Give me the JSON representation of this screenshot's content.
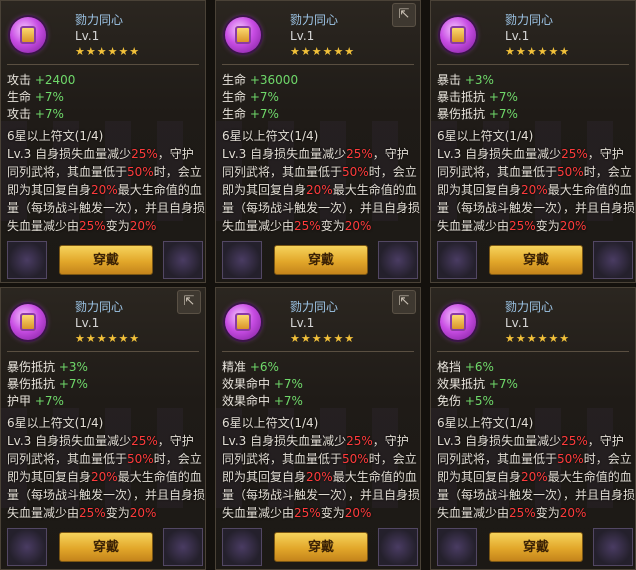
{
  "cards": [
    {
      "title": "勠力同心",
      "level": "Lv.1",
      "stars": "★★★★★★",
      "stats": [
        {
          "label": "攻击",
          "value": "+2400"
        },
        {
          "label": "生命",
          "value": "+7%"
        },
        {
          "label": "攻击",
          "value": "+7%"
        }
      ],
      "desc": {
        "line1": "6星以上符文(1/4)",
        "p1": "Lv.3  自身损失血量减少",
        "r1": "25%",
        "p2": "，守护同列武将，其血量低于",
        "r2": "50%",
        "p3": "时，会立即为其回复自身",
        "r3": "20%",
        "p4": "最大生命值的血量（每场战斗触发一次），并且自身损失血量减少由",
        "r4": "25%",
        "p5": "变为",
        "r5": "20%"
      },
      "button": "穿戴"
    },
    {
      "title": "勠力同心",
      "level": "Lv.1",
      "stars": "★★★★★★",
      "stats": [
        {
          "label": "生命",
          "value": "+36000"
        },
        {
          "label": "生命",
          "value": "+7%"
        },
        {
          "label": "生命",
          "value": "+7%"
        }
      ],
      "desc": {
        "line1": "6星以上符文(1/4)",
        "p1": "Lv.3  自身损失血量减少",
        "r1": "25%",
        "p2": "，守护同列武将，其血量低于",
        "r2": "50%",
        "p3": "时，会立即为其回复自身",
        "r3": "20%",
        "p4": "最大生命值的血量（每场战斗触发一次），并且自身损失血量减少由",
        "r4": "25%",
        "p5": "变为",
        "r5": "20%"
      },
      "button": "穿戴"
    },
    {
      "title": "勠力同心",
      "level": "Lv.1",
      "stars": "★★★★★★",
      "stats": [
        {
          "label": "暴击",
          "value": "+3%"
        },
        {
          "label": "暴击抵抗",
          "value": "+7%"
        },
        {
          "label": "暴伤抵抗",
          "value": "+7%"
        }
      ],
      "desc": {
        "line1": "6星以上符文(1/4)",
        "p1": "Lv.3  自身损失血量减少",
        "r1": "25%",
        "p2": "，守护同列武将，其血量低于",
        "r2": "50%",
        "p3": "时，会立即为其回复自身",
        "r3": "20%",
        "p4": "最大生命值的血量（每场战斗触发一次），并且自身损失血量减少由",
        "r4": "25%",
        "p5": "变为",
        "r5": "20%"
      },
      "button": "穿戴"
    },
    {
      "title": "勠力同心",
      "level": "Lv.1",
      "stars": "★★★★★★",
      "stats": [
        {
          "label": "暴伤抵抗",
          "value": "+3%"
        },
        {
          "label": "暴伤抵抗",
          "value": "+7%"
        },
        {
          "label": "护甲",
          "value": "+7%"
        }
      ],
      "desc": {
        "line1": "6星以上符文(1/4)",
        "p1": "Lv.3  自身损失血量减少",
        "r1": "25%",
        "p2": "，守护同列武将，其血量低于",
        "r2": "50%",
        "p3": "时，会立即为其回复自身",
        "r3": "20%",
        "p4": "最大生命值的血量（每场战斗触发一次），并且自身损失血量减少由",
        "r4": "25%",
        "p5": "变为",
        "r5": "20%"
      },
      "button": "穿戴"
    },
    {
      "title": "勠力同心",
      "level": "Lv.1",
      "stars": "★★★★★★",
      "stats": [
        {
          "label": "精准",
          "value": "+6%"
        },
        {
          "label": "效果命中",
          "value": "+7%"
        },
        {
          "label": "效果命中",
          "value": "+7%"
        }
      ],
      "desc": {
        "line1": "6星以上符文(1/4)",
        "p1": "Lv.3  自身损失血量减少",
        "r1": "25%",
        "p2": "，守护同列武将，其血量低于",
        "r2": "50%",
        "p3": "时，会立即为其回复自身",
        "r3": "20%",
        "p4": "最大生命值的血量（每场战斗触发一次），并且自身损失血量减少由",
        "r4": "25%",
        "p5": "变为",
        "r5": "20%"
      },
      "button": "穿戴"
    },
    {
      "title": "勠力同心",
      "level": "Lv.1",
      "stars": "★★★★★★",
      "stats": [
        {
          "label": "格挡",
          "value": "+6%"
        },
        {
          "label": "效果抵抗",
          "value": "+7%"
        },
        {
          "label": "免伤",
          "value": "+5%"
        }
      ],
      "desc": {
        "line1": "6星以上符文(1/4)",
        "p1": "Lv.3  自身损失血量减少",
        "r1": "25%",
        "p2": "，守护同列武将，其血量低于",
        "r2": "50%",
        "p3": "时，会立即为其回复自身",
        "r3": "20%",
        "p4": "最大生命值的血量（每场战斗触发一次），并且自身损失血量减少由",
        "r4": "25%",
        "p5": "变为",
        "r5": "20%"
      },
      "button": "穿戴"
    }
  ],
  "icons": {
    "share": "share-icon",
    "gem": "rune-gem-icon"
  }
}
